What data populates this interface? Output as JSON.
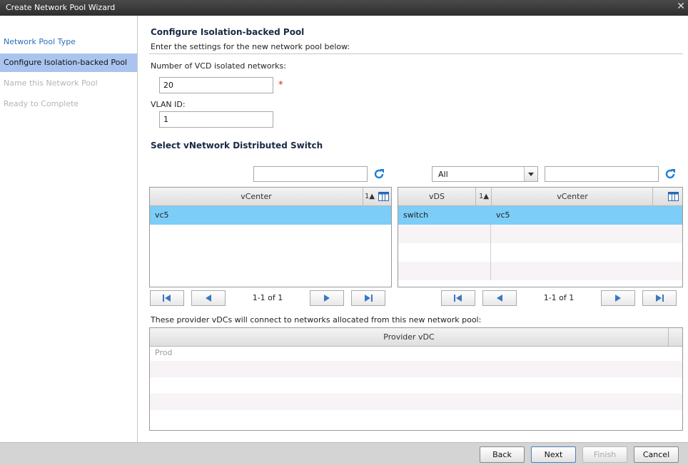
{
  "window": {
    "title": "Create Network Pool Wizard"
  },
  "steps": [
    {
      "label": "Network Pool Type"
    },
    {
      "label": "Configure Isolation-backed Pool"
    },
    {
      "label": "Name this Network Pool"
    },
    {
      "label": "Ready to Complete"
    }
  ],
  "section": {
    "title": "Configure Isolation-backed Pool",
    "subtitle": "Enter the settings for the new network pool below:"
  },
  "form": {
    "networks_label": "Number of VCD isolated networks:",
    "networks_value": "20",
    "vlan_label": "VLAN ID:",
    "vlan_value": "1"
  },
  "switch_section": {
    "title": "Select vNetwork Distributed Switch"
  },
  "left_grid": {
    "search_value": "",
    "col_vcenter": "vCenter",
    "sort_indicator": "1",
    "rows": [
      {
        "vcenter": "vc5"
      }
    ],
    "pager": "1-1 of 1"
  },
  "right_grid": {
    "filter_selected": "All",
    "search_value": "",
    "col_vds": "vDS",
    "sort_indicator": "1",
    "col_vcenter": "vCenter",
    "rows": [
      {
        "vds": "switch",
        "vcenter": "vc5"
      }
    ],
    "pager": "1-1 of 1"
  },
  "provider": {
    "note": "These provider vDCs will connect to networks allocated from this new network pool:",
    "col": "Provider vDC",
    "rows": [
      {
        "name": "Prod"
      }
    ]
  },
  "footer": {
    "back": "Back",
    "next": "Next",
    "finish": "Finish",
    "cancel": "Cancel"
  },
  "colors": {
    "accent": "#2b6fb6",
    "selection": "#7ccdf7",
    "active_step": "#a9c5ef"
  }
}
